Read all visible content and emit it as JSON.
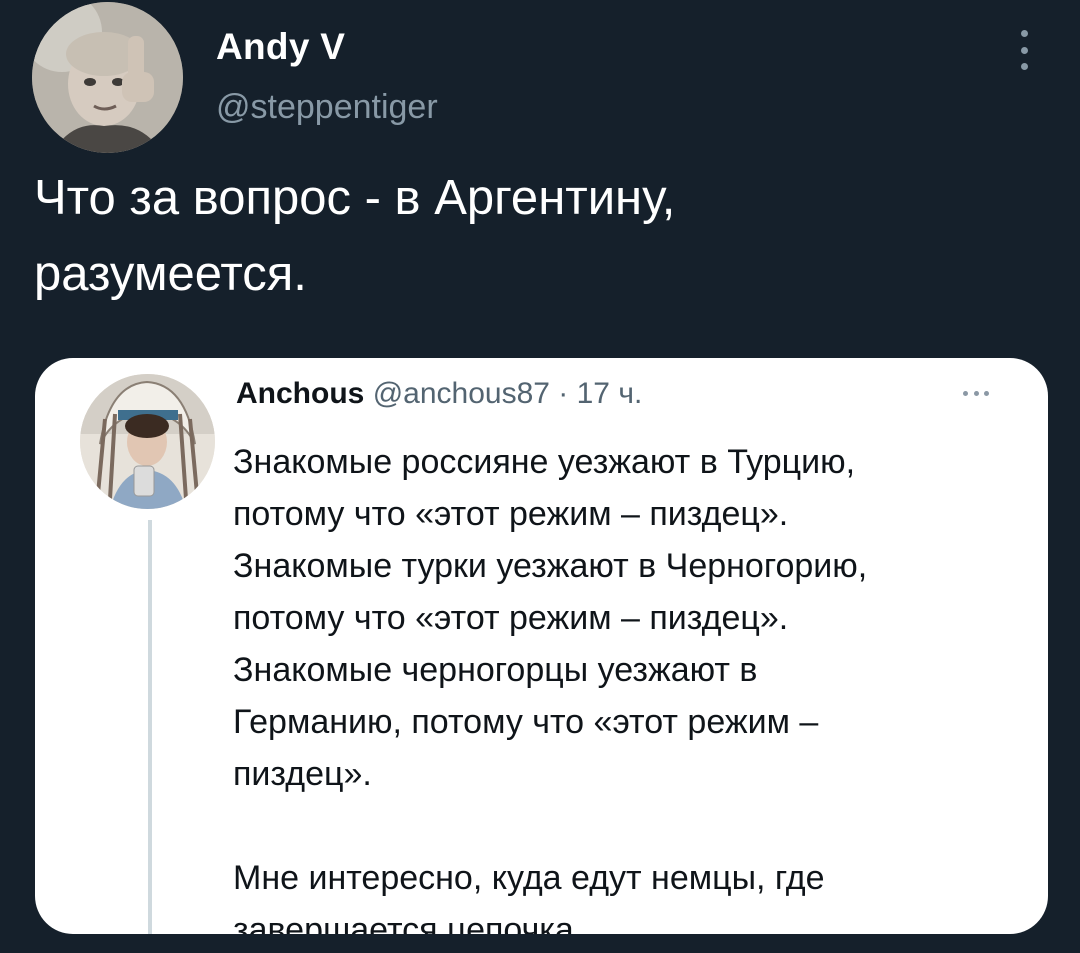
{
  "tweet": {
    "author_name": "Andy V",
    "author_handle": "@steppentiger",
    "more_icon": "more-vertical-icon",
    "text": "Что за вопрос - в Аргентину,\nразумеется."
  },
  "quoted_tweet": {
    "author_name": "Anchous",
    "author_handle": "@anchous87",
    "separator": "·",
    "time": "17 ч.",
    "more_icon": "more-horizontal-icon",
    "text": "Знакомые россияне уезжают в Турцию,\nпотому что «этот режим – пиздец».\nЗнакомые турки уезжают в Черногорию,\nпотому что «этот режим – пиздец».\nЗнакомые черногорцы уезжают в\nГерманию, потому что «этот режим –\nпиздец».\n\nМне интересно, куда едут немцы, где\nзавершается цепочка."
  },
  "colors": {
    "background": "#15202b",
    "card": "#ffffff",
    "secondary_text": "#8899a6",
    "thread_line": "#cfd9de"
  }
}
